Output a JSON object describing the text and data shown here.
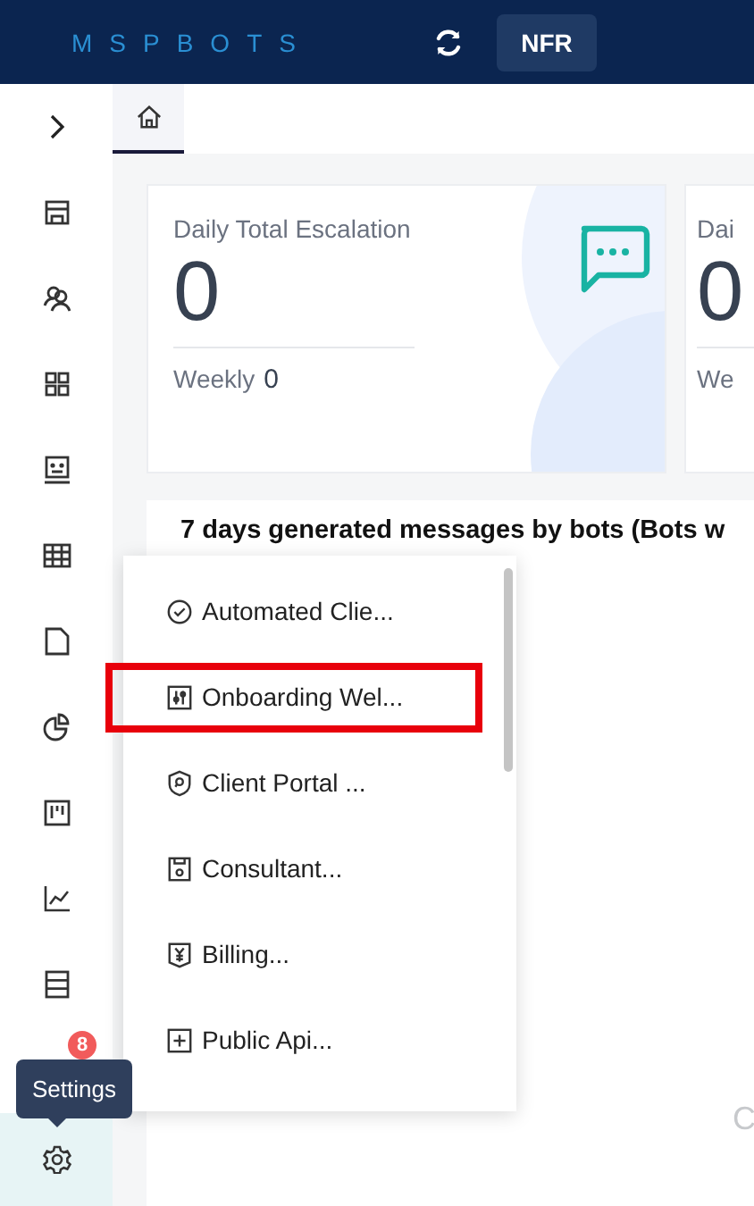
{
  "header": {
    "logo": "MSPBOTS",
    "workspace_button": "NFR"
  },
  "sidebar": {
    "items": [
      {
        "selected": false
      },
      {
        "selected": false
      },
      {
        "selected": false
      },
      {
        "selected": false
      },
      {
        "selected": false
      },
      {
        "selected": false
      },
      {
        "selected": false
      },
      {
        "selected": false
      },
      {
        "selected": false
      },
      {
        "selected": false
      },
      {
        "selected": false
      },
      {
        "selected": false,
        "badge": "8"
      },
      {
        "selected": true,
        "tooltip": "Settings"
      }
    ]
  },
  "tabs": [
    {
      "kind": "home",
      "selected": true
    }
  ],
  "cards": [
    {
      "title": "Daily Total Escalation",
      "value": "0",
      "weekly_label": "Weekly",
      "weekly_value": "0"
    },
    {
      "title": "Dai",
      "value": "0",
      "weekly_label": "We"
    }
  ],
  "chart_panel": {
    "title": "7 days generated messages by bots (Bots w",
    "footer_text": "C"
  },
  "menu": {
    "items": [
      {
        "label": "Automated Clie...",
        "highlighted": false
      },
      {
        "label": "Onboarding Wel...",
        "highlighted": true
      },
      {
        "label": "Client Portal ...",
        "highlighted": false
      },
      {
        "label": "Consultant...",
        "highlighted": false
      },
      {
        "label": "Billing...",
        "highlighted": false
      },
      {
        "label": "Public Api...",
        "highlighted": false
      }
    ]
  }
}
